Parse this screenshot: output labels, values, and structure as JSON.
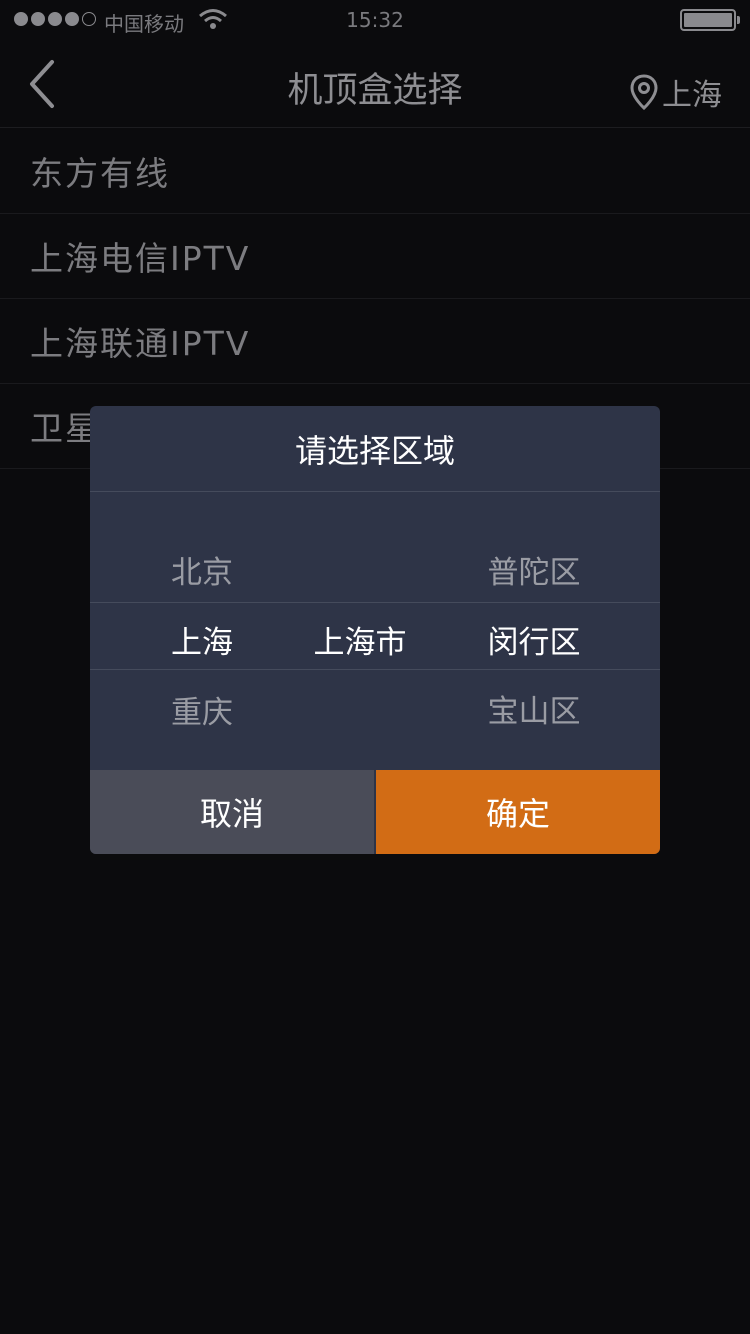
{
  "status_bar": {
    "carrier": "中国移动",
    "time": "15:32",
    "signal_bars_filled": 4,
    "signal_bars_total": 5
  },
  "nav": {
    "title": "机顶盒选择",
    "location": "上海",
    "back_icon": "chevron-left-icon",
    "location_icon": "map-pin-icon"
  },
  "list": {
    "items": [
      {
        "label": "东方有线"
      },
      {
        "label": "上海电信IPTV"
      },
      {
        "label": "上海联通IPTV"
      },
      {
        "label": "卫星"
      }
    ]
  },
  "dialog": {
    "title": "请选择区域",
    "picker": {
      "province": {
        "above": "北京",
        "selected": "上海",
        "below": "重庆"
      },
      "city": {
        "above": "",
        "selected": "上海市",
        "below": ""
      },
      "district": {
        "above": "普陀区",
        "selected": "闵行区",
        "below": "宝山区"
      }
    },
    "cancel_label": "取消",
    "confirm_label": "确定"
  },
  "colors": {
    "accent": "#d26c15",
    "dialog_bg": "#2e3447",
    "cancel_bg": "#4a4c58",
    "page_bg": "#0b0b0d"
  }
}
